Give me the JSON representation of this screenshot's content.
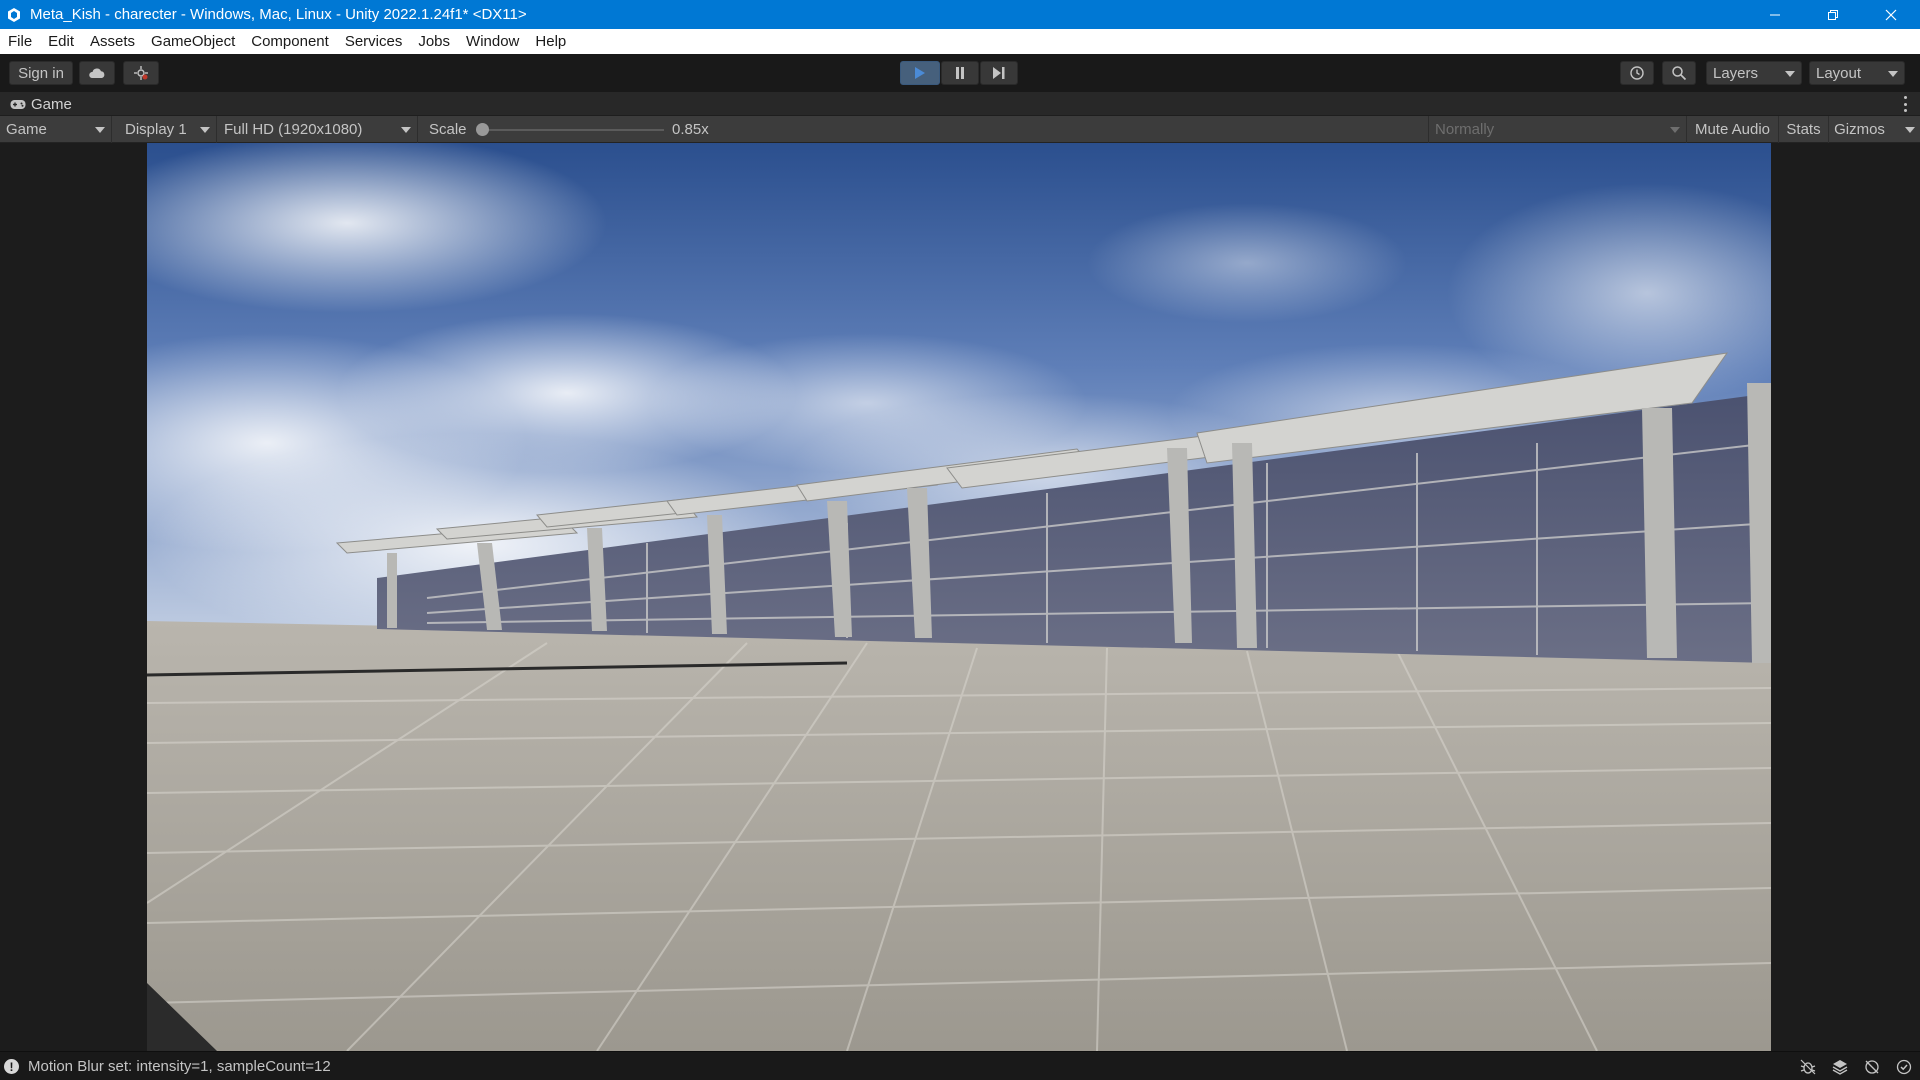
{
  "window": {
    "title": "Meta_Kish - charecter - Windows, Mac, Linux - Unity 2022.1.24f1* <DX11>"
  },
  "menu": [
    "File",
    "Edit",
    "Assets",
    "GameObject",
    "Component",
    "Services",
    "Jobs",
    "Window",
    "Help"
  ],
  "toolbar": {
    "sign_in": "Sign in",
    "layers": "Layers",
    "layout": "Layout",
    "play_state": "playing"
  },
  "tab": {
    "label": "Game"
  },
  "game_view": {
    "mode": "Game",
    "display": "Display 1",
    "resolution": "Full HD (1920x1080)",
    "scale_label": "Scale",
    "scale_value": "0.85x",
    "play_focus": "Normally",
    "mute_audio": "Mute Audio",
    "stats": "Stats",
    "gizmos": "Gizmos"
  },
  "status": {
    "message": "Motion Blur set: intensity=1, sampleCount=12"
  },
  "colors": {
    "title_bar": "#0078d4",
    "play_active": "#4b8bd6",
    "sky_top": "#2b4f8e",
    "floor": "#a9a59c"
  }
}
